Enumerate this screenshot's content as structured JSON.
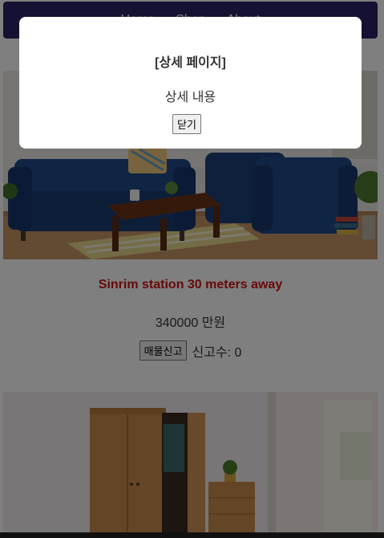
{
  "nav": {
    "links": [
      "Home",
      "Shop",
      "About"
    ]
  },
  "listings": [
    {
      "title": "Sinrim station 30 meters away",
      "price": "340000 만원",
      "report_button": "매물신고",
      "report_count": "신고수: 0",
      "image": "living-room-sofa-photo"
    },
    {
      "image": "wardrobe-photo"
    }
  ],
  "modal": {
    "title": "[상세 페이지]",
    "content": "상세 내용",
    "close_button": "닫기"
  }
}
